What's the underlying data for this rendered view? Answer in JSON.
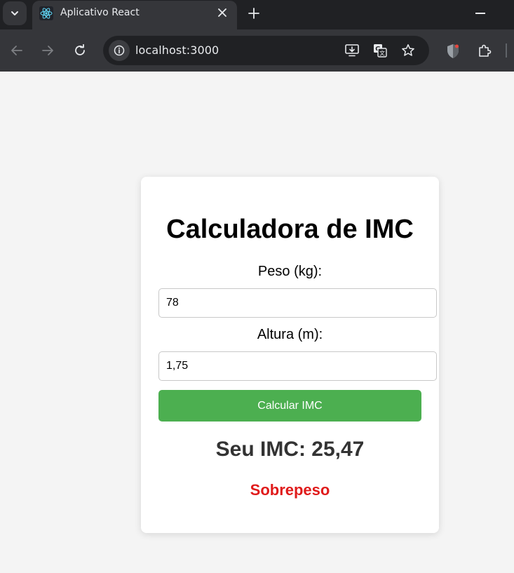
{
  "browser": {
    "tab": {
      "title": "Aplicativo React"
    },
    "address_bar": {
      "url": "localhost:3000"
    },
    "icons": {
      "tab_search": "chevron-down-icon",
      "favicon": "react-icon",
      "tab_close": "close-icon",
      "new_tab": "plus-icon",
      "minimize": "minimize-icon",
      "back": "arrow-left-icon",
      "forward": "arrow-right-icon",
      "reload": "reload-icon",
      "site_info": "info-icon",
      "install": "install-app-icon",
      "translate": "translate-icon",
      "bookmark": "star-icon",
      "extension_shield": "shield-icon",
      "extensions": "puzzle-icon"
    }
  },
  "page": {
    "title": "Calculadora de IMC",
    "weight": {
      "label": "Peso (kg):",
      "value": "78"
    },
    "height": {
      "label": "Altura (m):",
      "value": "1,75"
    },
    "calculate_label": "Calcular IMC",
    "result": "Seu IMC: 25,47",
    "category": "Sobrepeso"
  },
  "colors": {
    "button": "#4caf50",
    "category_text": "#e01b1b",
    "page_background": "#f4f4f4",
    "chrome_dark": "#202124",
    "chrome_toolbar": "#35363a"
  }
}
